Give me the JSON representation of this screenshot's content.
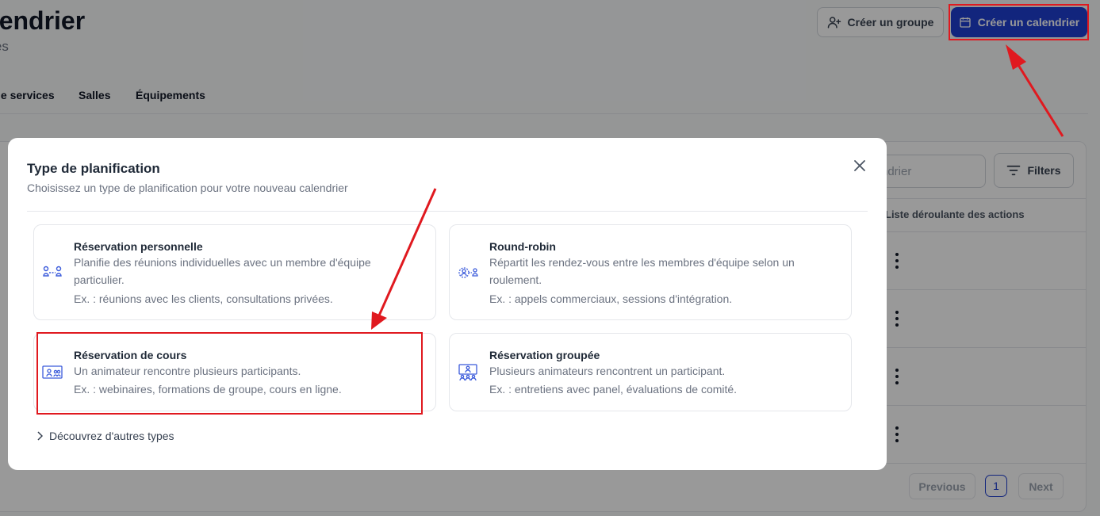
{
  "header": {
    "title": "alendrier",
    "subtitle": "upes",
    "create_group_label": "Créer un groupe",
    "create_calendar_label": "Créer un calendrier"
  },
  "tabs": [
    {
      "label": "le services"
    },
    {
      "label": "Salles"
    },
    {
      "label": "Équipements"
    }
  ],
  "table": {
    "search_placeholder": "ndrier",
    "filters_label": "Filters",
    "actions_column": "Liste déroulante des actions",
    "pagination": {
      "previous": "Previous",
      "page": "1",
      "next": "Next"
    }
  },
  "modal": {
    "title": "Type de planification",
    "subtitle": "Choisissez un type de planification pour votre nouveau calendrier",
    "options": [
      {
        "title": "Réservation personnelle",
        "description": "Planifie des réunions individuelles avec un membre d'équipe particulier.",
        "example": "Ex. : réunions avec les clients, consultations privées.",
        "icon": "one-to-one-icon"
      },
      {
        "title": "Round-robin",
        "description": "Répartit les rendez-vous entre les membres d'équipe selon un roulement.",
        "example": "Ex. : appels commerciaux, sessions d'intégration.",
        "icon": "round-robin-icon"
      },
      {
        "title": "Réservation de cours",
        "description": "Un animateur rencontre plusieurs participants.",
        "example": "Ex. : webinaires, formations de groupe, cours en ligne.",
        "icon": "class-booking-icon"
      },
      {
        "title": "Réservation groupée",
        "description": "Plusieurs animateurs rencontrent un participant.",
        "example": "Ex. : entretiens avec panel, évaluations de comité.",
        "icon": "collective-booking-icon"
      }
    ],
    "more_label": "Découvrez d'autres types"
  },
  "colors": {
    "primary": "#1f3fd0",
    "annotation": "#e0191f",
    "icon_blue": "#3b5bdb"
  }
}
